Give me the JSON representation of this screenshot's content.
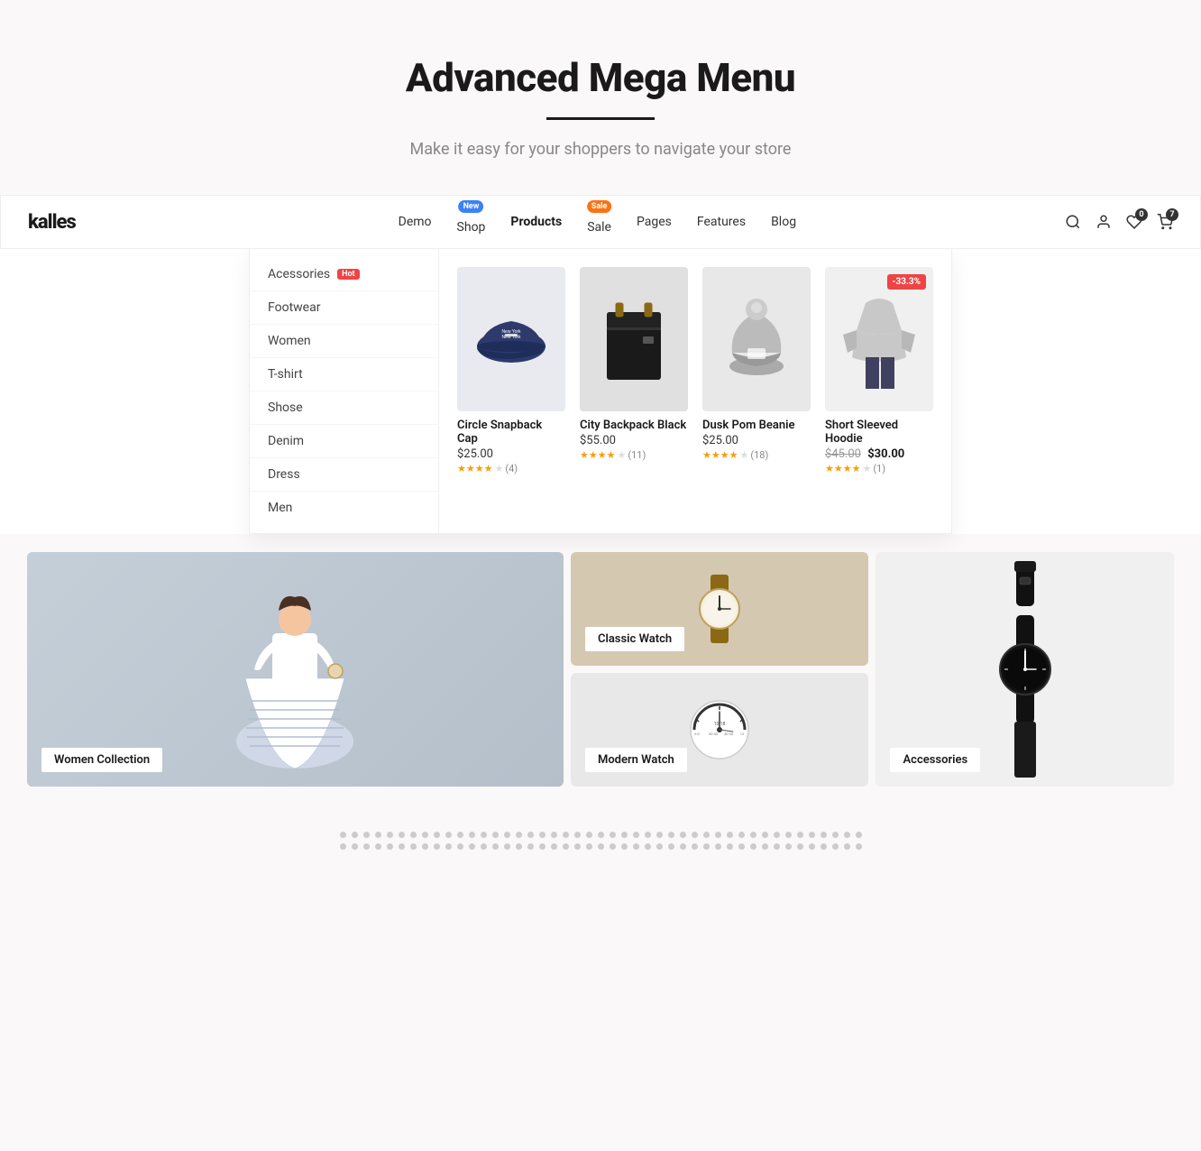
{
  "hero": {
    "title": "Advanced Mega Menu",
    "subtitle": "Make it easy for your shoppers to navigate your store"
  },
  "navbar": {
    "logo": "kalles",
    "nav_items": [
      {
        "label": "Demo",
        "badge": null
      },
      {
        "label": "Shop",
        "badge": {
          "text": "New",
          "color": "blue"
        }
      },
      {
        "label": "Products",
        "badge": null,
        "active": true
      },
      {
        "label": "Sale",
        "badge": {
          "text": "Sale",
          "color": "orange"
        }
      },
      {
        "label": "Pages",
        "badge": null
      },
      {
        "label": "Features",
        "badge": null
      },
      {
        "label": "Blog",
        "badge": null
      }
    ],
    "icons": {
      "search": "🔍",
      "user": "👤",
      "wishlist": "♡",
      "wishlist_count": "0",
      "cart": "🛒",
      "cart_count": "7"
    }
  },
  "mega_menu": {
    "title": "Products",
    "sidebar_items": [
      {
        "label": "Acessories",
        "badge": "Hot"
      },
      {
        "label": "Footwear"
      },
      {
        "label": "Women"
      },
      {
        "label": "T-shirt"
      },
      {
        "label": "Shose"
      },
      {
        "label": "Denim"
      },
      {
        "label": "Dress"
      },
      {
        "label": "Men"
      }
    ],
    "products": [
      {
        "name": "Circle Snapback Cap",
        "price": "$25.00",
        "old_price": null,
        "new_price": null,
        "on_sale": false,
        "stars": 4,
        "review_count": 4,
        "color": "#2d3a6b",
        "type": "cap"
      },
      {
        "name": "City Backpack Black",
        "price": "$55.00",
        "old_price": null,
        "new_price": null,
        "on_sale": false,
        "stars": 4,
        "review_count": 11,
        "color": "#1a1a1a",
        "type": "bag"
      },
      {
        "name": "Dusk Pom Beanie",
        "price": "$25.00",
        "old_price": null,
        "new_price": null,
        "on_sale": false,
        "stars": 4,
        "review_count": 18,
        "color": "#888",
        "type": "beanie"
      },
      {
        "name": "Short Sleeved Hoodie",
        "price": null,
        "old_price": "$45.00",
        "new_price": "$30.00",
        "on_sale": true,
        "sale_badge": "-33.3%",
        "stars": 4,
        "review_count": 1,
        "color": "#c0c0c0",
        "type": "hoodie"
      }
    ]
  },
  "banners": [
    {
      "label": "Women Collection",
      "type": "large"
    },
    {
      "label": "Classic Watch",
      "type": "small-top"
    },
    {
      "label": "Modern Watch",
      "type": "small-bottom"
    },
    {
      "label": "Accessories",
      "type": "col3"
    }
  ],
  "dots": {
    "rows": 2,
    "count_per_row": 45
  }
}
